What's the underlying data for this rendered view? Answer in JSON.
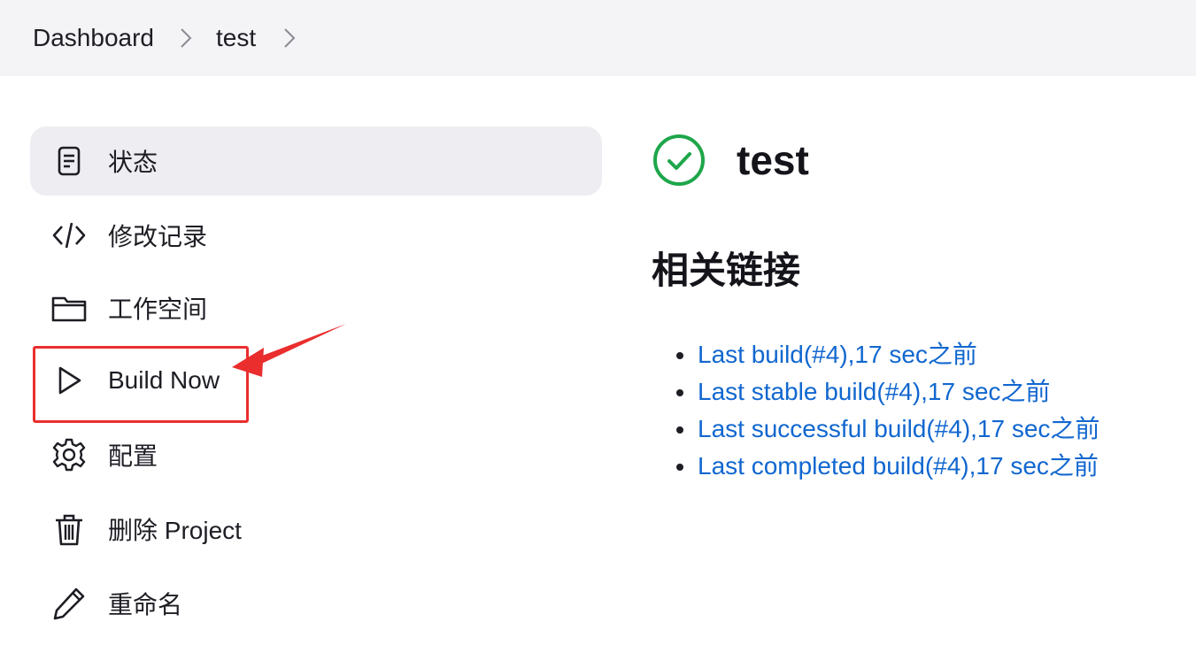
{
  "breadcrumb": {
    "items": [
      {
        "label": "Dashboard"
      },
      {
        "label": "test"
      }
    ],
    "separator_icon": "chevron-right-icon"
  },
  "sidebar": {
    "items": [
      {
        "label": "状态",
        "icon": "document-icon",
        "active": true
      },
      {
        "label": "修改记录",
        "icon": "code-icon"
      },
      {
        "label": "工作空间",
        "icon": "folder-icon"
      },
      {
        "label": "Build Now",
        "icon": "play-icon",
        "highlighted": true
      },
      {
        "label": "配置",
        "icon": "gear-icon"
      },
      {
        "label": "删除 Project",
        "icon": "trash-icon"
      },
      {
        "label": "重命名",
        "icon": "pencil-icon"
      }
    ]
  },
  "main": {
    "title": "test",
    "status_icon": "success-check-icon",
    "related_heading": "相关链接",
    "links": [
      {
        "label": "Last build(#4),17 sec之前"
      },
      {
        "label": "Last stable build(#4),17 sec之前"
      },
      {
        "label": "Last successful build(#4),17 sec之前"
      },
      {
        "label": "Last completed build(#4),17 sec之前"
      }
    ]
  },
  "annotation": {
    "color": "#ea2e2e"
  },
  "colors": {
    "link": "#1167cf",
    "success": "#1ea64a",
    "breadcrumb_bg": "#f4f4f6",
    "active_item_bg": "#eeeef2"
  }
}
